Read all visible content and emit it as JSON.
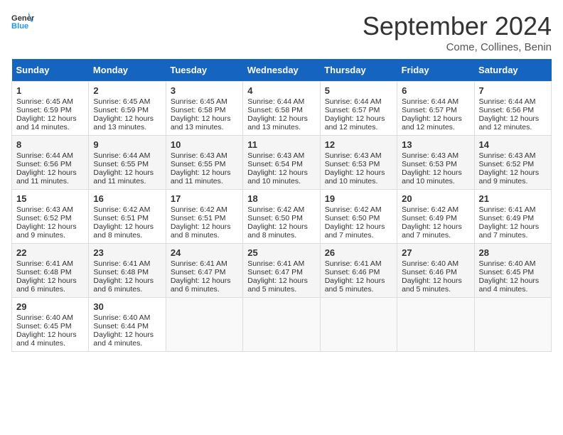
{
  "logo": {
    "line1": "General",
    "line2": "Blue"
  },
  "title": "September 2024",
  "subtitle": "Come, Collines, Benin",
  "headers": [
    "Sunday",
    "Monday",
    "Tuesday",
    "Wednesday",
    "Thursday",
    "Friday",
    "Saturday"
  ],
  "weeks": [
    [
      {
        "day": "1",
        "lines": [
          "Sunrise: 6:45 AM",
          "Sunset: 6:59 PM",
          "Daylight: 12 hours",
          "and 14 minutes."
        ]
      },
      {
        "day": "2",
        "lines": [
          "Sunrise: 6:45 AM",
          "Sunset: 6:59 PM",
          "Daylight: 12 hours",
          "and 13 minutes."
        ]
      },
      {
        "day": "3",
        "lines": [
          "Sunrise: 6:45 AM",
          "Sunset: 6:58 PM",
          "Daylight: 12 hours",
          "and 13 minutes."
        ]
      },
      {
        "day": "4",
        "lines": [
          "Sunrise: 6:44 AM",
          "Sunset: 6:58 PM",
          "Daylight: 12 hours",
          "and 13 minutes."
        ]
      },
      {
        "day": "5",
        "lines": [
          "Sunrise: 6:44 AM",
          "Sunset: 6:57 PM",
          "Daylight: 12 hours",
          "and 12 minutes."
        ]
      },
      {
        "day": "6",
        "lines": [
          "Sunrise: 6:44 AM",
          "Sunset: 6:57 PM",
          "Daylight: 12 hours",
          "and 12 minutes."
        ]
      },
      {
        "day": "7",
        "lines": [
          "Sunrise: 6:44 AM",
          "Sunset: 6:56 PM",
          "Daylight: 12 hours",
          "and 12 minutes."
        ]
      }
    ],
    [
      {
        "day": "8",
        "lines": [
          "Sunrise: 6:44 AM",
          "Sunset: 6:56 PM",
          "Daylight: 12 hours",
          "and 11 minutes."
        ]
      },
      {
        "day": "9",
        "lines": [
          "Sunrise: 6:44 AM",
          "Sunset: 6:55 PM",
          "Daylight: 12 hours",
          "and 11 minutes."
        ]
      },
      {
        "day": "10",
        "lines": [
          "Sunrise: 6:43 AM",
          "Sunset: 6:55 PM",
          "Daylight: 12 hours",
          "and 11 minutes."
        ]
      },
      {
        "day": "11",
        "lines": [
          "Sunrise: 6:43 AM",
          "Sunset: 6:54 PM",
          "Daylight: 12 hours",
          "and 10 minutes."
        ]
      },
      {
        "day": "12",
        "lines": [
          "Sunrise: 6:43 AM",
          "Sunset: 6:53 PM",
          "Daylight: 12 hours",
          "and 10 minutes."
        ]
      },
      {
        "day": "13",
        "lines": [
          "Sunrise: 6:43 AM",
          "Sunset: 6:53 PM",
          "Daylight: 12 hours",
          "and 10 minutes."
        ]
      },
      {
        "day": "14",
        "lines": [
          "Sunrise: 6:43 AM",
          "Sunset: 6:52 PM",
          "Daylight: 12 hours",
          "and 9 minutes."
        ]
      }
    ],
    [
      {
        "day": "15",
        "lines": [
          "Sunrise: 6:43 AM",
          "Sunset: 6:52 PM",
          "Daylight: 12 hours",
          "and 9 minutes."
        ]
      },
      {
        "day": "16",
        "lines": [
          "Sunrise: 6:42 AM",
          "Sunset: 6:51 PM",
          "Daylight: 12 hours",
          "and 8 minutes."
        ]
      },
      {
        "day": "17",
        "lines": [
          "Sunrise: 6:42 AM",
          "Sunset: 6:51 PM",
          "Daylight: 12 hours",
          "and 8 minutes."
        ]
      },
      {
        "day": "18",
        "lines": [
          "Sunrise: 6:42 AM",
          "Sunset: 6:50 PM",
          "Daylight: 12 hours",
          "and 8 minutes."
        ]
      },
      {
        "day": "19",
        "lines": [
          "Sunrise: 6:42 AM",
          "Sunset: 6:50 PM",
          "Daylight: 12 hours",
          "and 7 minutes."
        ]
      },
      {
        "day": "20",
        "lines": [
          "Sunrise: 6:42 AM",
          "Sunset: 6:49 PM",
          "Daylight: 12 hours",
          "and 7 minutes."
        ]
      },
      {
        "day": "21",
        "lines": [
          "Sunrise: 6:41 AM",
          "Sunset: 6:49 PM",
          "Daylight: 12 hours",
          "and 7 minutes."
        ]
      }
    ],
    [
      {
        "day": "22",
        "lines": [
          "Sunrise: 6:41 AM",
          "Sunset: 6:48 PM",
          "Daylight: 12 hours",
          "and 6 minutes."
        ]
      },
      {
        "day": "23",
        "lines": [
          "Sunrise: 6:41 AM",
          "Sunset: 6:48 PM",
          "Daylight: 12 hours",
          "and 6 minutes."
        ]
      },
      {
        "day": "24",
        "lines": [
          "Sunrise: 6:41 AM",
          "Sunset: 6:47 PM",
          "Daylight: 12 hours",
          "and 6 minutes."
        ]
      },
      {
        "day": "25",
        "lines": [
          "Sunrise: 6:41 AM",
          "Sunset: 6:47 PM",
          "Daylight: 12 hours",
          "and 5 minutes."
        ]
      },
      {
        "day": "26",
        "lines": [
          "Sunrise: 6:41 AM",
          "Sunset: 6:46 PM",
          "Daylight: 12 hours",
          "and 5 minutes."
        ]
      },
      {
        "day": "27",
        "lines": [
          "Sunrise: 6:40 AM",
          "Sunset: 6:46 PM",
          "Daylight: 12 hours",
          "and 5 minutes."
        ]
      },
      {
        "day": "28",
        "lines": [
          "Sunrise: 6:40 AM",
          "Sunset: 6:45 PM",
          "Daylight: 12 hours",
          "and 4 minutes."
        ]
      }
    ],
    [
      {
        "day": "29",
        "lines": [
          "Sunrise: 6:40 AM",
          "Sunset: 6:45 PM",
          "Daylight: 12 hours",
          "and 4 minutes."
        ]
      },
      {
        "day": "30",
        "lines": [
          "Sunrise: 6:40 AM",
          "Sunset: 6:44 PM",
          "Daylight: 12 hours",
          "and 4 minutes."
        ]
      },
      {
        "day": "",
        "lines": []
      },
      {
        "day": "",
        "lines": []
      },
      {
        "day": "",
        "lines": []
      },
      {
        "day": "",
        "lines": []
      },
      {
        "day": "",
        "lines": []
      }
    ]
  ]
}
